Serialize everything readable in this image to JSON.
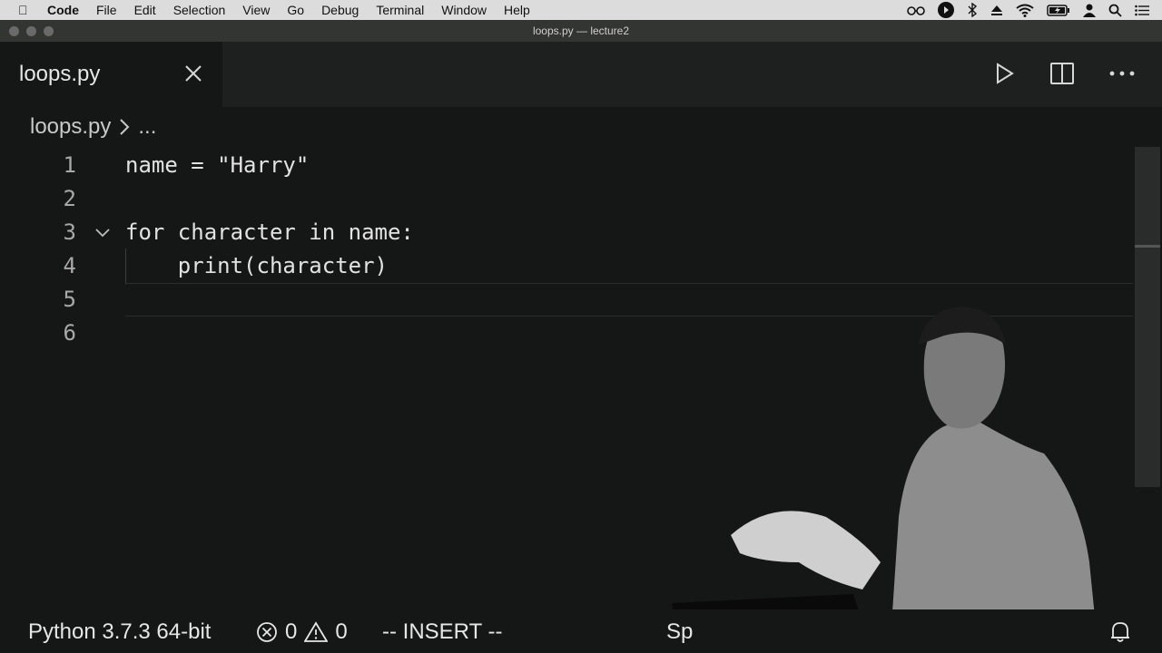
{
  "menubar": {
    "items": [
      "Code",
      "File",
      "Edit",
      "Selection",
      "View",
      "Go",
      "Debug",
      "Terminal",
      "Window",
      "Help"
    ]
  },
  "window": {
    "title": "loops.py — lecture2"
  },
  "tab": {
    "filename": "loops.py"
  },
  "breadcrumb": {
    "file": "loops.py",
    "ellipsis": "..."
  },
  "editor": {
    "lines": [
      {
        "number": "1",
        "code": "name = \"Harry\""
      },
      {
        "number": "2",
        "code": ""
      },
      {
        "number": "3",
        "code": "for character in name:"
      },
      {
        "number": "4",
        "code": "    print(character)"
      },
      {
        "number": "5",
        "code": ""
      },
      {
        "number": "6",
        "code": ""
      }
    ]
  },
  "statusbar": {
    "interpreter": "Python 3.7.3 64-bit",
    "errors": "0",
    "warnings": "0",
    "vim_mode": "-- INSERT --",
    "spaces_partial": "Sp"
  }
}
